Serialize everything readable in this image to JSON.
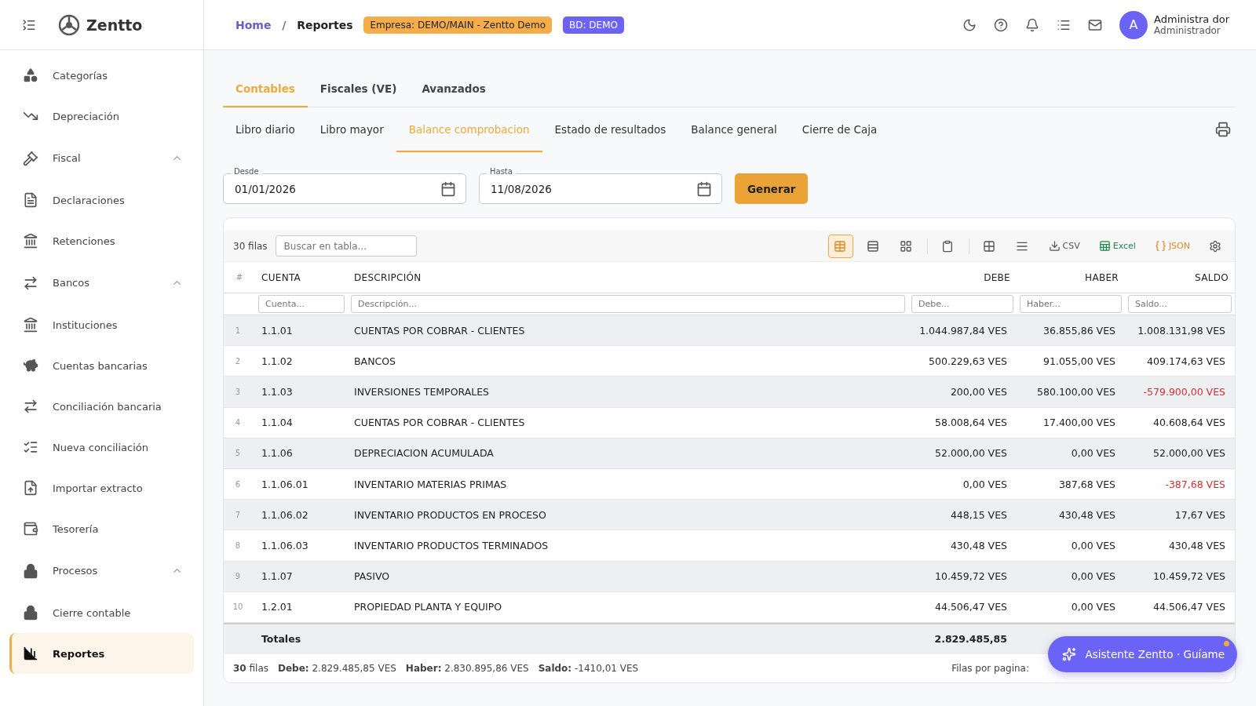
{
  "sidebar": {
    "brand": "Zentto",
    "items": [
      {
        "label": "Categorías",
        "selected": false
      },
      {
        "label": "Depreciación",
        "selected": false
      },
      {
        "label": "Fiscal",
        "selected": false,
        "expanded": true,
        "children": [
          {
            "label": "Declaraciones",
            "selected": false
          },
          {
            "label": "Retenciones",
            "selected": false
          }
        ]
      },
      {
        "label": "Bancos",
        "selected": false,
        "expanded": true,
        "children": [
          {
            "label": "Instituciones",
            "selected": false
          },
          {
            "label": "Cuentas bancarias",
            "selected": false
          },
          {
            "label": "Conciliación bancaria",
            "selected": false
          },
          {
            "label": "Nueva conciliación",
            "selected": false
          },
          {
            "label": "Importar extracto",
            "selected": false
          },
          {
            "label": "Tesorería",
            "selected": false
          }
        ]
      },
      {
        "label": "Procesos",
        "selected": false,
        "expanded": true,
        "children": [
          {
            "label": "Cierre contable",
            "selected": false
          },
          {
            "label": "Reportes",
            "selected": true
          }
        ]
      }
    ]
  },
  "header": {
    "breadcrumb": [
      "Home",
      "Reportes"
    ],
    "breadcrumb_separator": "/",
    "company_badge": "Empresa: DEMO/MAIN - Zentto Demo",
    "db_badge": "BD: DEMO",
    "user": {
      "initial": "A",
      "name": "Administra dor",
      "role": "Administrador"
    }
  },
  "tabs": [
    {
      "label": "Contables",
      "selected": true
    },
    {
      "label": "Fiscales (VE)",
      "selected": false
    },
    {
      "label": "Avanzados",
      "selected": false
    }
  ],
  "subtabs": [
    {
      "label": "Libro diario",
      "selected": false
    },
    {
      "label": "Libro mayor",
      "selected": false
    },
    {
      "label": "Balance comprobacion",
      "selected": true
    },
    {
      "label": "Estado de resultados",
      "selected": false
    },
    {
      "label": "Balance general",
      "selected": false
    },
    {
      "label": "Cierre de Caja",
      "selected": false
    }
  ],
  "filters": {
    "from": {
      "label": "Desde",
      "value": "01/01/2026"
    },
    "to": {
      "label": "Hasta",
      "value": "11/08/2026"
    },
    "button": "Generar"
  },
  "table": {
    "row_count": "30 filas",
    "search_placeholder": "Buscar en tabla...",
    "views": [
      {
        "selected": true
      },
      {
        "selected": false
      },
      {
        "selected": false
      }
    ],
    "exports": [
      "CSV",
      "Excel",
      "JSON"
    ],
    "columns": [
      "#",
      "CUENTA",
      "DESCRIPCIÓN",
      "DEBE",
      "HABER",
      "SALDO"
    ],
    "column_filters": [
      {
        "placeholder": "Cuenta..."
      },
      {
        "placeholder": "Descripción..."
      },
      {
        "placeholder": "Debe..."
      },
      {
        "placeholder": "Haber..."
      },
      {
        "placeholder": "Saldo..."
      }
    ],
    "rows": [
      {
        "n": "1",
        "cuenta": "1.1.01",
        "descripcion": "CUENTAS POR COBRAR - CLIENTES",
        "debe": "1.044.987,84 VES",
        "haber": "36.855,86 VES",
        "saldo": "1.008.131,98 VES",
        "negative": false
      },
      {
        "n": "2",
        "cuenta": "1.1.02",
        "descripcion": "BANCOS",
        "debe": "500.229,63 VES",
        "haber": "91.055,00 VES",
        "saldo": "409.174,63 VES",
        "negative": false
      },
      {
        "n": "3",
        "cuenta": "1.1.03",
        "descripcion": "INVERSIONES TEMPORALES",
        "debe": "200,00 VES",
        "haber": "580.100,00 VES",
        "saldo": "-579.900,00 VES",
        "negative": true
      },
      {
        "n": "4",
        "cuenta": "1.1.04",
        "descripcion": "CUENTAS POR COBRAR - CLIENTES",
        "debe": "58.008,64 VES",
        "haber": "17.400,00 VES",
        "saldo": "40.608,64 VES",
        "negative": false
      },
      {
        "n": "5",
        "cuenta": "1.1.06",
        "descripcion": "DEPRECIACION ACUMULADA",
        "debe": "52.000,00 VES",
        "haber": "0,00 VES",
        "saldo": "52.000,00 VES",
        "negative": false
      },
      {
        "n": "6",
        "cuenta": "1.1.06.01",
        "descripcion": "INVENTARIO MATERIAS PRIMAS",
        "debe": "0,00 VES",
        "haber": "387,68 VES",
        "saldo": "-387,68 VES",
        "negative": true
      },
      {
        "n": "7",
        "cuenta": "1.1.06.02",
        "descripcion": "INVENTARIO PRODUCTOS EN PROCESO",
        "debe": "448,15 VES",
        "haber": "430,48 VES",
        "saldo": "17,67 VES",
        "negative": false
      },
      {
        "n": "8",
        "cuenta": "1.1.06.03",
        "descripcion": "INVENTARIO PRODUCTOS TERMINADOS",
        "debe": "430,48 VES",
        "haber": "0,00 VES",
        "saldo": "430,48 VES",
        "negative": false
      },
      {
        "n": "9",
        "cuenta": "1.1.07",
        "descripcion": "PASIVO",
        "debe": "10.459,72 VES",
        "haber": "0,00 VES",
        "saldo": "10.459,72 VES",
        "negative": false
      },
      {
        "n": "10",
        "cuenta": "1.2.01",
        "descripcion": "PROPIEDAD PLANTA Y EQUIPO",
        "debe": "44.506,47 VES",
        "haber": "0,00 VES",
        "saldo": "44.506,47 VES",
        "negative": false
      }
    ],
    "totals": {
      "label": "Totales",
      "debe": "2.829.485,85"
    },
    "footer": {
      "count": "**30** filas",
      "debe": "**Debe:** 2.829.485,85 VES",
      "haber": "**Haber:** 2.830.895,86 VES",
      "saldo": "**Saldo:** -1410,01 VES",
      "per_page": "Filas por pagina:"
    }
  },
  "assistant": {
    "label": "Asistente Zentto · Guíame",
    "notification": true
  }
}
